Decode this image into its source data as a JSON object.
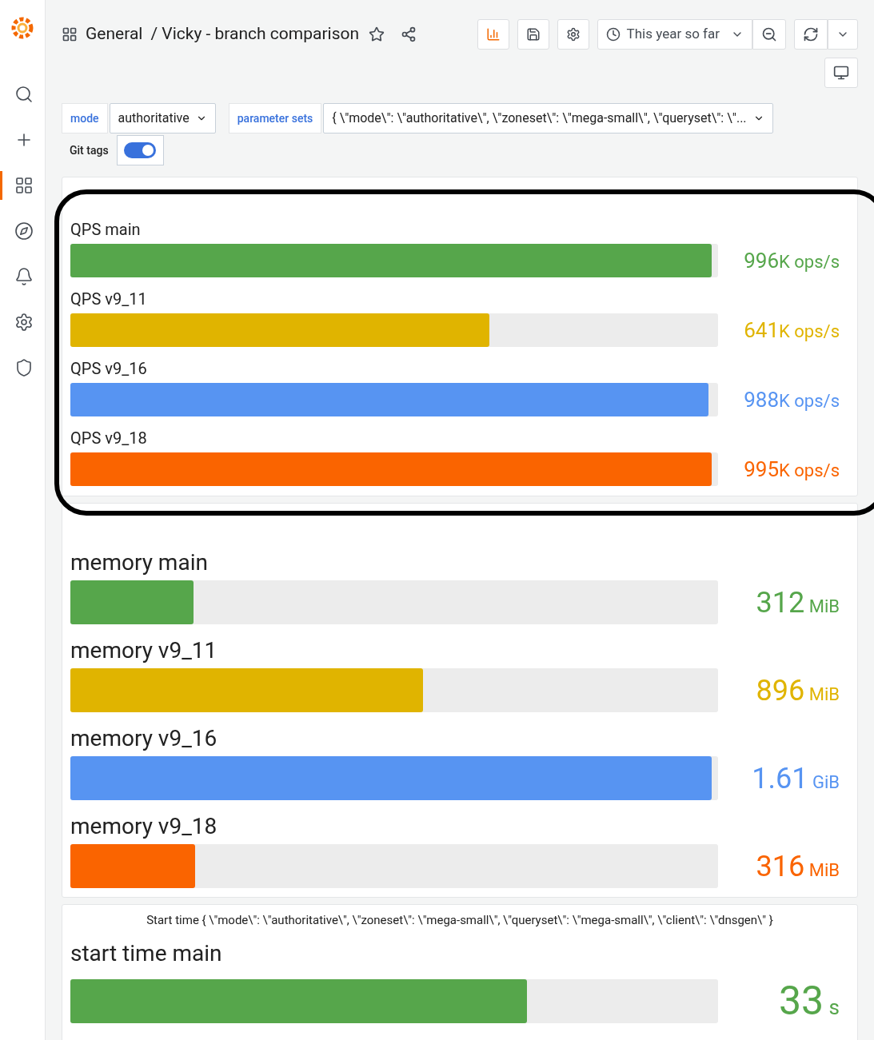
{
  "sidebar": {
    "items": [
      {
        "kind": "search",
        "selected": false
      },
      {
        "kind": "create",
        "selected": false
      },
      {
        "kind": "dashboards",
        "selected": true
      },
      {
        "kind": "explore",
        "selected": false
      },
      {
        "kind": "alerting",
        "selected": false
      },
      {
        "kind": "configuration",
        "selected": false
      },
      {
        "kind": "admin",
        "selected": false
      }
    ]
  },
  "header": {
    "folder": "General",
    "title": "/ Vicky - branch comparison",
    "time_range": "This year so far"
  },
  "variables": [
    {
      "label": "mode",
      "value": "authoritative"
    },
    {
      "label": "parameter sets",
      "value": "{ \\\"mode\\\": \\\"authoritative\\\", \\\"zoneset\\\": \\\"mega-small\\\", \\\"queryset\\\": \\\"..."
    }
  ],
  "git_tags": {
    "label": "Git tags",
    "on": true
  },
  "panels": [
    {
      "kind": "compact",
      "rows": [
        {
          "label": "QPS main",
          "value": "996",
          "unit": "K ops/s",
          "level": 0.99,
          "color": "#56a64b"
        },
        {
          "label": "QPS v9_11",
          "value": "641",
          "unit": "K ops/s",
          "level": 0.647,
          "color": "#e0b400"
        },
        {
          "label": "QPS v9_16",
          "value": "988",
          "unit": "K ops/s",
          "level": 0.985,
          "color": "#5794f2"
        },
        {
          "label": "QPS v9_18",
          "value": "995",
          "unit": "K ops/s",
          "level": 0.99,
          "color": "#fa6400"
        }
      ]
    },
    {
      "kind": "medium",
      "rows": [
        {
          "label": "memory main",
          "value": "312",
          "unit": "MiB",
          "level": 0.19,
          "color": "#56a64b"
        },
        {
          "label": "memory v9_11",
          "value": "896",
          "unit": "MiB",
          "level": 0.545,
          "color": "#e0b400"
        },
        {
          "label": "memory v9_16",
          "value": "1.61",
          "unit": "GiB",
          "level": 0.99,
          "color": "#5794f2"
        },
        {
          "label": "memory v9_18",
          "value": "316",
          "unit": "MiB",
          "level": 0.192,
          "color": "#fa6400"
        }
      ]
    },
    {
      "kind": "large",
      "title": "Start time { \\\"mode\\\": \\\"authoritative\\\", \\\"zoneset\\\": \\\"mega-small\\\", \\\"queryset\\\": \\\"mega-small\\\", \\\"client\\\": \\\"dnsgen\\\" }",
      "rows": [
        {
          "label": "start time main",
          "value": "33",
          "unit": "s",
          "level": 0.705,
          "color": "#56a64b"
        }
      ]
    }
  ]
}
